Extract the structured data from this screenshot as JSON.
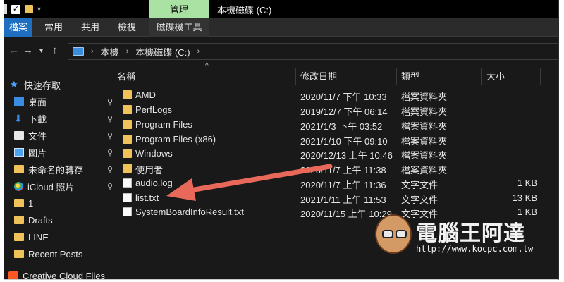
{
  "window": {
    "title": "本機磁碟 (C:)",
    "context_tab": "管理"
  },
  "ribbon": {
    "tabs": [
      "檔案",
      "常用",
      "共用",
      "檢視",
      "磁碟機工具"
    ]
  },
  "address": {
    "crumbs": [
      "本機",
      "本機磁碟 (C:)"
    ]
  },
  "nav": {
    "items": [
      {
        "label": "快速存取",
        "icon": "star-icon"
      },
      {
        "label": "桌面",
        "icon": "desktop-folder-icon"
      },
      {
        "label": "下載",
        "icon": "download-arrow-icon"
      },
      {
        "label": "文件",
        "icon": "document-icon"
      },
      {
        "label": "圖片",
        "icon": "picture-icon"
      },
      {
        "label": "未命名的轉存",
        "icon": "folder-icon"
      },
      {
        "label": "iCloud 照片",
        "icon": "icloud-photos-icon"
      },
      {
        "label": "1",
        "icon": "folder-icon"
      },
      {
        "label": "Drafts",
        "icon": "folder-icon"
      },
      {
        "label": "LINE",
        "icon": "folder-icon"
      },
      {
        "label": "Recent Posts",
        "icon": "folder-icon"
      },
      {
        "label": "Creative Cloud Files",
        "icon": "creative-cloud-icon"
      }
    ],
    "pin_symbol": "📌"
  },
  "columns": {
    "name": "名稱",
    "date": "修改日期",
    "type": "類型",
    "size": "大小"
  },
  "files": [
    {
      "name": "AMD",
      "date": "2020/11/7 下午 10:33",
      "type": "檔案資料夾",
      "size": "",
      "kind": "folder"
    },
    {
      "name": "PerfLogs",
      "date": "2019/12/7 下午 06:14",
      "type": "檔案資料夾",
      "size": "",
      "kind": "folder"
    },
    {
      "name": "Program Files",
      "date": "2021/1/3 下午 03:52",
      "type": "檔案資料夾",
      "size": "",
      "kind": "folder"
    },
    {
      "name": "Program Files (x86)",
      "date": "2021/1/10 下午 09:10",
      "type": "檔案資料夾",
      "size": "",
      "kind": "folder"
    },
    {
      "name": "Windows",
      "date": "2020/12/13 上午 10:46",
      "type": "檔案資料夾",
      "size": "",
      "kind": "folder"
    },
    {
      "name": "使用者",
      "date": "2020/11/7 上午 11:38",
      "type": "檔案資料夾",
      "size": "",
      "kind": "folder"
    },
    {
      "name": "audio.log",
      "date": "2020/11/7 上午 11:36",
      "type": "文字文件",
      "size": "1 KB",
      "kind": "file"
    },
    {
      "name": "list.txt",
      "date": "2021/1/11 上午 11:53",
      "type": "文字文件",
      "size": "13 KB",
      "kind": "file"
    },
    {
      "name": "SystemBoardInfoResult.txt",
      "date": "2020/11/15 上午 10:29",
      "type": "文字文件",
      "size": "1 KB",
      "kind": "file"
    }
  ],
  "watermark": {
    "brand": "電腦王阿達",
    "url": "http://www.kocpc.com.tw"
  },
  "colors": {
    "background": "#191919",
    "file_tab": "#1f6fc1",
    "context_tab": "#a9e2a3",
    "folder": "#f0c35a",
    "annotation_arrow": "#e8685a"
  }
}
